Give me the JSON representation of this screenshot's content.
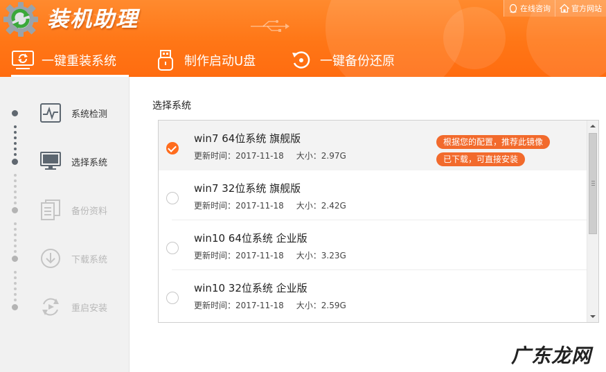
{
  "app": {
    "title": "装机助理",
    "title_color": "#ffffff",
    "brand_color": "#ff7616",
    "accent_color": "#ff6c1d",
    "logo_icon": "gear-refresh-logo"
  },
  "top_links": [
    {
      "label": "在线咨询",
      "icon": "qq-penguin-icon"
    },
    {
      "label": "官方网站",
      "icon": "home-icon"
    }
  ],
  "nav": [
    {
      "label": "一键重装系统",
      "icon": "monitor-refresh-icon",
      "active": true
    },
    {
      "label": "制作启动U盘",
      "icon": "usb-drive-icon",
      "active": false
    },
    {
      "label": "一键备份还原",
      "icon": "backup-restore-icon",
      "active": false
    }
  ],
  "steps": [
    {
      "label": "系统检测",
      "icon": "pulse-monitor-icon",
      "status": "done"
    },
    {
      "label": "选择系统",
      "icon": "monitor-icon",
      "status": "current"
    },
    {
      "label": "备份资料",
      "icon": "documents-icon",
      "status": "todo"
    },
    {
      "label": "下载系统",
      "icon": "download-icon",
      "status": "todo"
    },
    {
      "label": "重启安装",
      "icon": "restart-icon",
      "status": "todo"
    }
  ],
  "main": {
    "section_title": "选择系统",
    "systems": [
      {
        "name": "win7 64位系统 旗舰版",
        "updated": "更新时间：2017-11-18",
        "size": "大小：2.97G",
        "selected": true
      },
      {
        "name": "win7 32位系统 旗舰版",
        "updated": "更新时间：2017-11-18",
        "size": "大小：2.42G",
        "selected": false
      },
      {
        "name": "win10 64位系统 企业版",
        "updated": "更新时间：2017-11-18",
        "size": "大小：3.23G",
        "selected": false
      },
      {
        "name": "win10 32位系统 企业版",
        "updated": "更新时间：2017-11-18",
        "size": "大小：2.59G",
        "selected": false
      }
    ],
    "badges": {
      "recommend": "根据您的配置，推荐此镜像",
      "downloaded": "已下载，可直接安装"
    }
  },
  "watermark": "广东龙网"
}
